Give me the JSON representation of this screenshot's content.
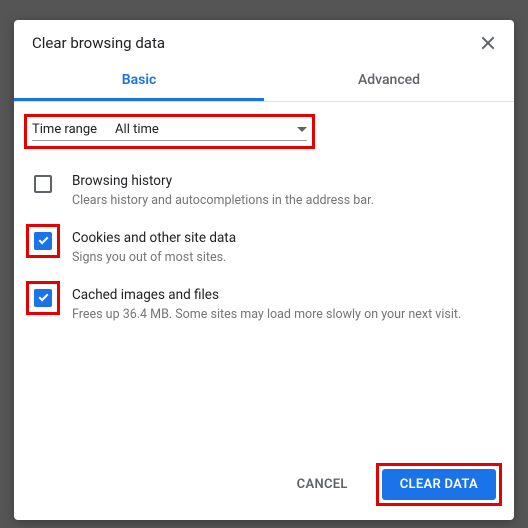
{
  "dialog": {
    "title": "Clear browsing data",
    "tabs": {
      "basic": "Basic",
      "advanced": "Advanced"
    },
    "timerange": {
      "label": "Time range",
      "value": "All time"
    },
    "options": [
      {
        "title": "Browsing history",
        "desc": "Clears history and autocompletions in the address bar.",
        "checked": false,
        "highlighted": false
      },
      {
        "title": "Cookies and other site data",
        "desc": "Signs you out of most sites.",
        "checked": true,
        "highlighted": true
      },
      {
        "title": "Cached images and files",
        "desc": "Frees up 36.4 MB. Some sites may load more slowly on your next visit.",
        "checked": true,
        "highlighted": true
      }
    ],
    "actions": {
      "cancel": "Cancel",
      "clear": "Clear data"
    }
  },
  "colors": {
    "accent": "#1a73e8",
    "highlight": "#e60000"
  }
}
